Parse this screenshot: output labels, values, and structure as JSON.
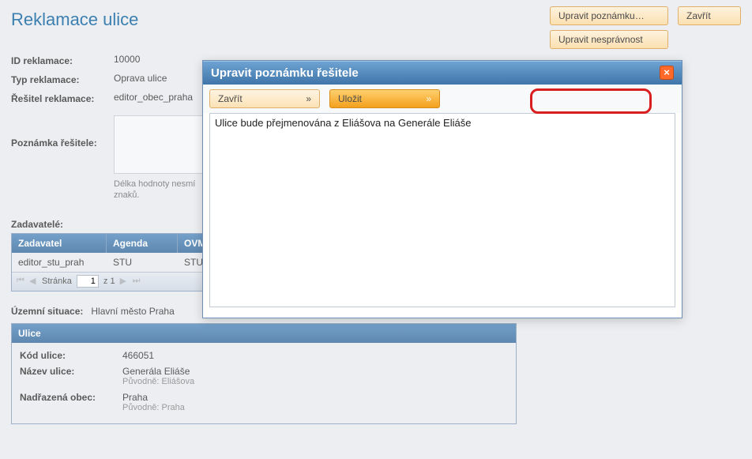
{
  "header": {
    "title": "Reklamace ulice",
    "buttons": {
      "edit_note": "Upravit poznámku…",
      "close": "Zavřít",
      "edit_wrongness": "Upravit nesprávnost"
    }
  },
  "fields": {
    "id": {
      "label": "ID reklamace:",
      "value": "10000"
    },
    "type": {
      "label": "Typ reklamace:",
      "value": "Oprava ulice"
    },
    "solver": {
      "label": "Řešitel reklamace:",
      "value": "editor_obec_praha"
    },
    "note": {
      "label": "Poznámka řešitele:",
      "value": "",
      "limit": "Délka hodnoty nesmí\nznaků."
    }
  },
  "submitters": {
    "section_label": "Zadavatelé:",
    "columns": {
      "c1": "Zadavatel",
      "c2": "Agenda",
      "c3": "OVM"
    },
    "row": {
      "c1": "editor_stu_prah",
      "c2": "STU",
      "c3": "STU"
    },
    "pager": {
      "page_label": "Stránka",
      "page": "1",
      "of_label": "z 1"
    }
  },
  "territory": {
    "label": "Územní situace:",
    "value": "Hlavní město Praha"
  },
  "ulice_panel": {
    "title": "Ulice",
    "kod": {
      "label": "Kód ulice:",
      "value": "466051"
    },
    "nazev": {
      "label": "Název ulice:",
      "value": "Generála Eliáše",
      "orig": "Původně: Eliášova"
    },
    "obec": {
      "label": "Nadřazená obec:",
      "value": "Praha",
      "orig": "Původně: Praha"
    }
  },
  "modal": {
    "title": "Upravit poznámku řešitele",
    "close_btn": "Zavřít",
    "save_btn": "Uložit",
    "text": "Ulice bude přejmenována z Eliášova na Generále Eliáše"
  }
}
